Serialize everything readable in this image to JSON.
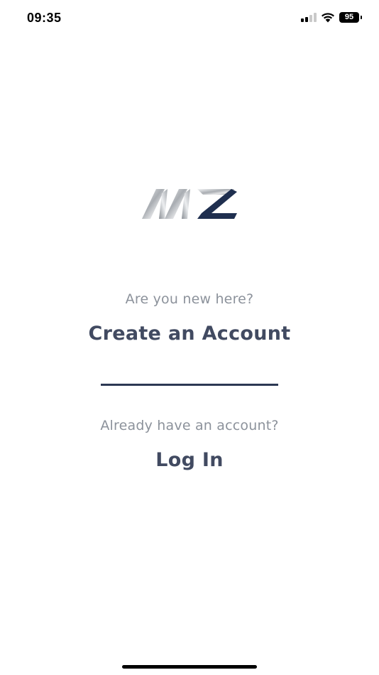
{
  "status_bar": {
    "time": "09:35",
    "battery_level": "95",
    "signal_bars_active": 2,
    "signal_bars_total": 4,
    "icons": [
      "signal-icon",
      "wifi-icon",
      "battery-icon"
    ]
  },
  "logo": {
    "icon": "mz-logo",
    "colors": {
      "silver": "#c7c9cc",
      "navy": "#1f2f4f"
    }
  },
  "register": {
    "prompt": "Are you new here?",
    "action_label": "Create an Account"
  },
  "login": {
    "prompt": "Already have an account?",
    "action_label": "Log In"
  },
  "colors": {
    "prompt_text": "#8c929b",
    "action_text": "#414a61",
    "divider": "#2c3853"
  }
}
